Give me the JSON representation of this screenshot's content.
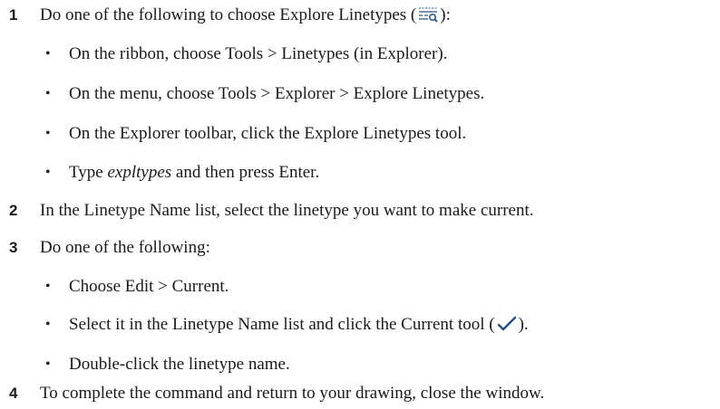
{
  "steps": [
    {
      "number": "1",
      "text_before_icon": "Do one of the following to choose Explore Linetypes (",
      "icon": "explore-linetypes-icon",
      "text_after_icon": "):",
      "bullets": [
        "On the ribbon, choose Tools > Linetypes (in Explorer).",
        "On the menu, choose Tools > Explorer > Explore Linetypes.",
        "On the Explorer toolbar, click the Explore Linetypes tool."
      ],
      "command_bullet": {
        "prefix": "Type ",
        "command": "expltypes",
        "suffix": " and then press Enter."
      }
    },
    {
      "number": "2",
      "text": "In the Linetype Name list, select the linetype you want to make current."
    },
    {
      "number": "3",
      "text": "Do one of the following:",
      "bullets": [
        "Choose Edit > Current."
      ],
      "icon_bullet": {
        "text_before_icon": "Select it in the Linetype Name list and click the Current tool (",
        "icon": "checkmark-icon",
        "text_after_icon": ")."
      },
      "last_bullet": "Double-click the linetype name."
    },
    {
      "number": "4",
      "text": "To complete the command and return to your drawing, close the window."
    }
  ]
}
